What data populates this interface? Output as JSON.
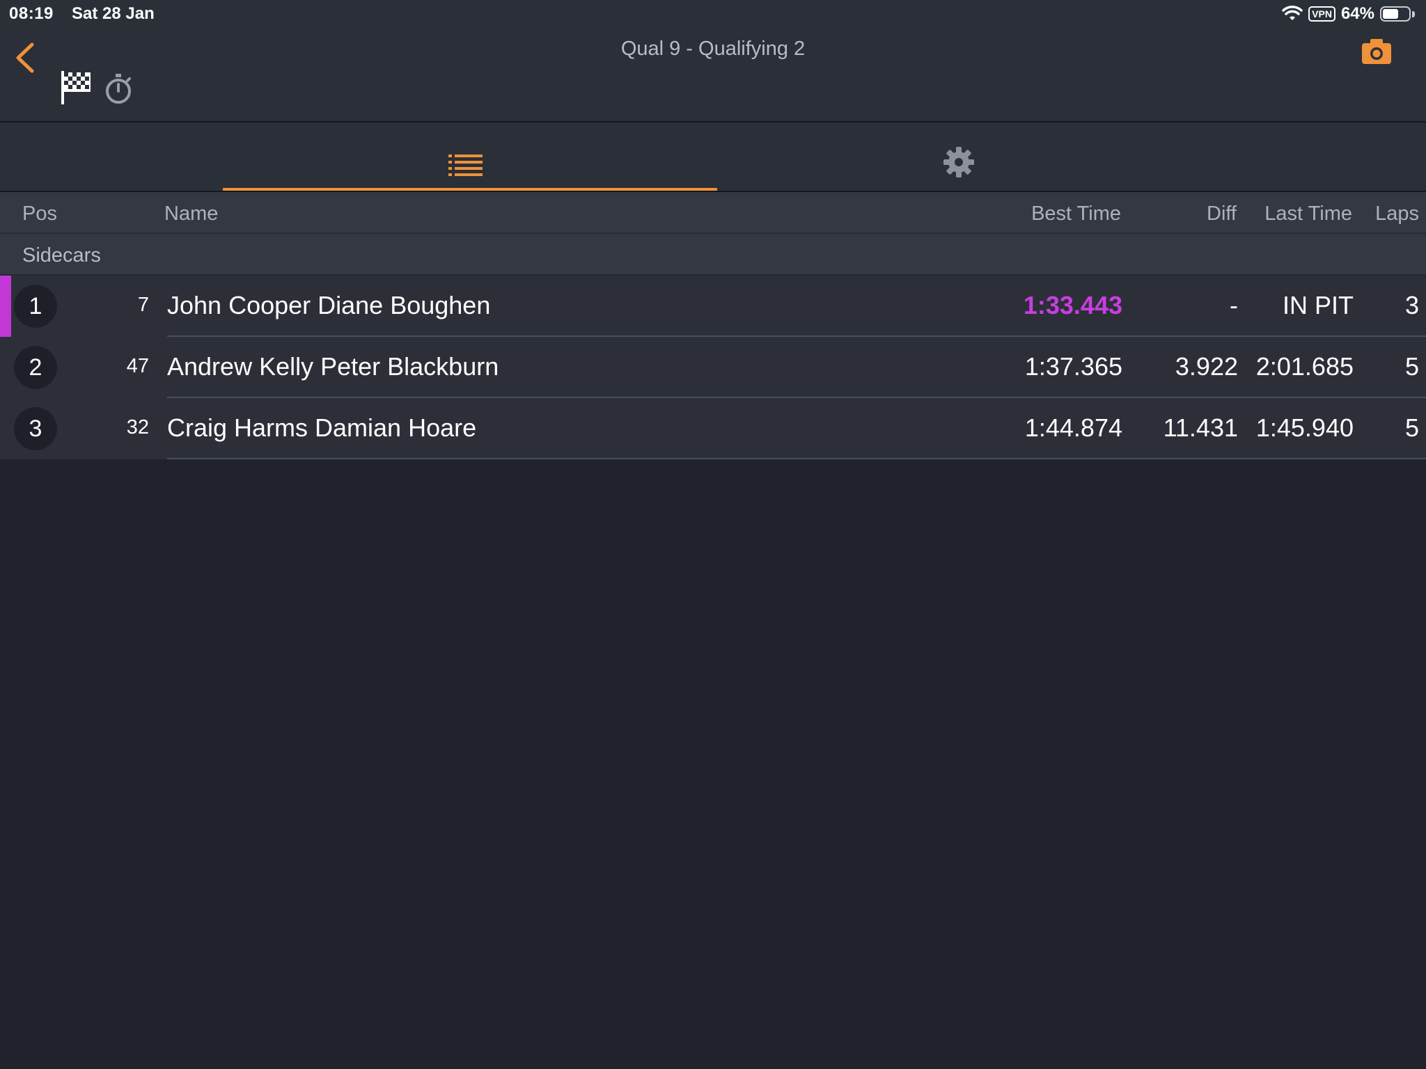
{
  "status_bar": {
    "time": "08:19",
    "date": "Sat 28 Jan",
    "vpn": "VPN",
    "battery": "64%",
    "battery_level": 0.64
  },
  "header": {
    "title": "Qual 9 - Qualifying 2",
    "icons": [
      "back-chevron",
      "checkered-flag",
      "stopwatch",
      "camera"
    ],
    "accent_color": "#f0923a"
  },
  "tabs": [
    {
      "icon": "list-icon",
      "selected": true
    },
    {
      "icon": "gear-icon",
      "selected": false
    }
  ],
  "table": {
    "columns": {
      "pos": "Pos",
      "name": "Name",
      "best": "Best Time",
      "diff": "Diff",
      "last": "Last Time",
      "laps": "Laps"
    },
    "class_label": "Sidecars",
    "fastest_color": "#c83ee0",
    "rows": [
      {
        "pos": "1",
        "num": "7",
        "name": "John Cooper Diane Boughen",
        "best": "1:33.443",
        "diff": "-",
        "last": "IN PIT",
        "laps": "3"
      },
      {
        "pos": "2",
        "num": "47",
        "name": "Andrew Kelly Peter Blackburn",
        "best": "1:37.365",
        "diff": "3.922",
        "last": "2:01.685",
        "laps": "5"
      },
      {
        "pos": "3",
        "num": "32",
        "name": "Craig Harms Damian Hoare",
        "best": "1:44.874",
        "diff": "11.431",
        "last": "1:45.940",
        "laps": "5"
      }
    ]
  }
}
